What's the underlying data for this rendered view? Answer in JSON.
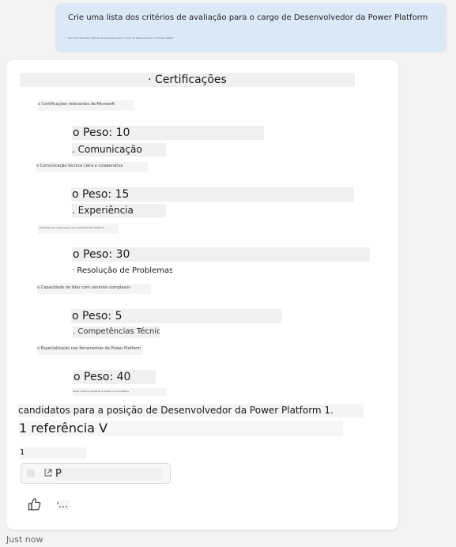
{
  "user_message": {
    "text": "Crie uma lista dos critérios de avaliação para o cargo de Desenvolvedor da Power Platform",
    "subtext": "Crie uma lista dos critérios de avaliação para o cargo de Desenvolvedor da Power Platform"
  },
  "response": {
    "heading": "· Certificações",
    "sections": [
      {
        "detail": "o Certificações relevantes da Microsoft",
        "peso": "o Peso: 10",
        "next_title": ". Comunicação"
      },
      {
        "detail": "o Comunicação técnica clara e colaborativa",
        "peso": "o Peso: 15",
        "next_title": ". Experiência"
      },
      {
        "detail": "o Experiência comprovada com projetos Power Platform",
        "peso": "o Peso: 30",
        "next_title": "· Resolução de Problemas"
      },
      {
        "detail": "o Capacidade de lidar com cenários complexos",
        "peso": "o Peso: 5",
        "next_title": ". Competências Técnicas"
      },
      {
        "detail": "o Especialização nas ferramentas da Power Platform",
        "peso": "o Peso: 40",
        "next_title": ""
      }
    ],
    "tail_detail": "Estes critérios ajudarão a avaliar os candidatos",
    "summary": "candidatos para a posição de Desenvolvedor da Power Platform 1.",
    "references_label": "1 referência V",
    "reference_count": "1",
    "reference_chip_label": "P",
    "feedback": {
      "like_icon": "thumbs-up-icon",
      "more_icon": "more-icon"
    }
  },
  "timestamp": "Just now",
  "colors": {
    "background": "#f3f3f3",
    "user_bubble": "#dbe9f7",
    "card": "#ffffff",
    "text_block": "#f0f0f0"
  }
}
